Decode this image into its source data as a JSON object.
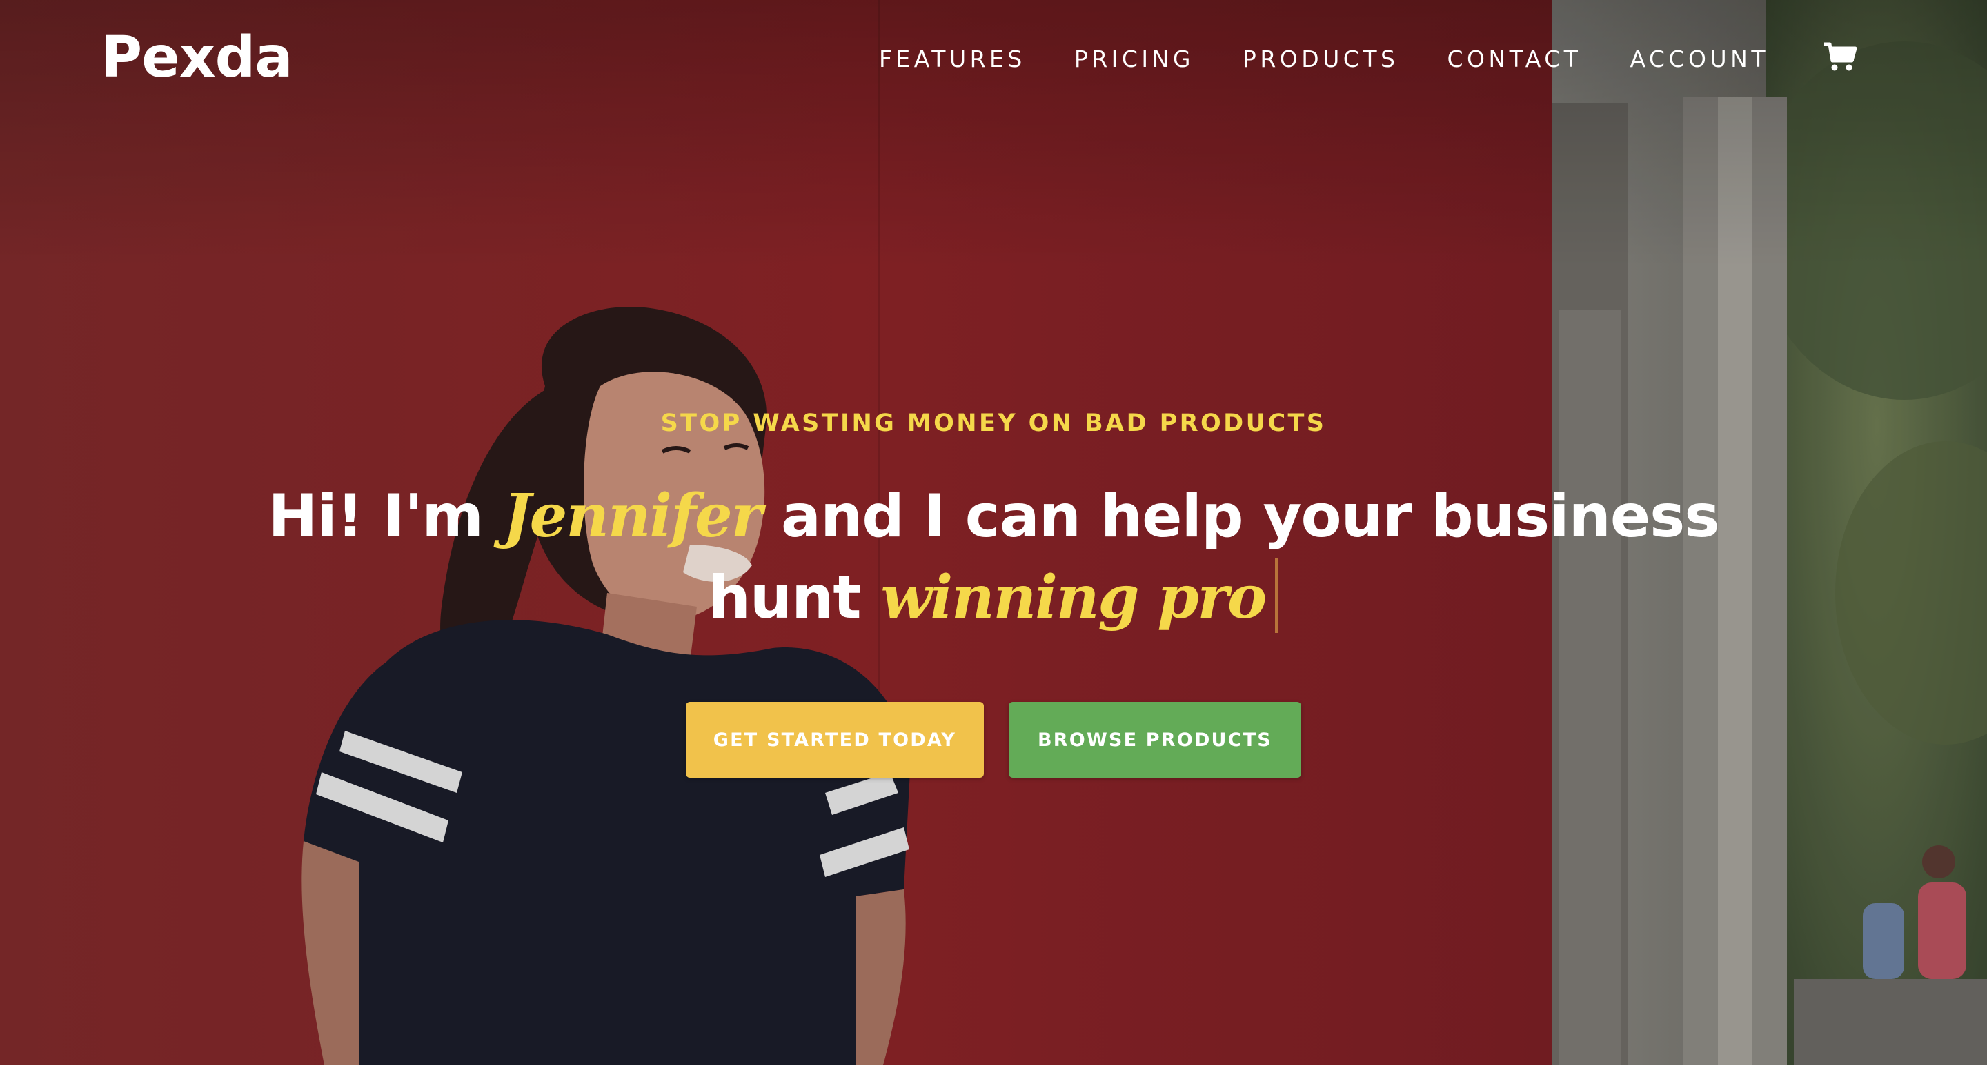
{
  "colors": {
    "accent_yellow": "#f5d84a",
    "button_yellow": "#f1c24b",
    "button_green": "#63ab57",
    "wall_red": "#8e2428"
  },
  "nav": {
    "logo": "Pexda",
    "items": [
      {
        "label": "FEATURES"
      },
      {
        "label": "PRICING"
      },
      {
        "label": "PRODUCTS"
      },
      {
        "label": "CONTACT"
      },
      {
        "label": "ACCOUNT"
      }
    ],
    "cart_icon": "shopping-cart-icon"
  },
  "hero": {
    "eyebrow": "STOP WASTING MONEY ON BAD PRODUCTS",
    "headline_part1": "Hi! I'm",
    "headline_name": "Jennifer",
    "headline_part2": "and I can help your business",
    "headline_part3": "hunt",
    "headline_typed": "winning pro",
    "primary_button": "GET STARTED TODAY",
    "secondary_button": "BROWSE PRODUCTS"
  }
}
